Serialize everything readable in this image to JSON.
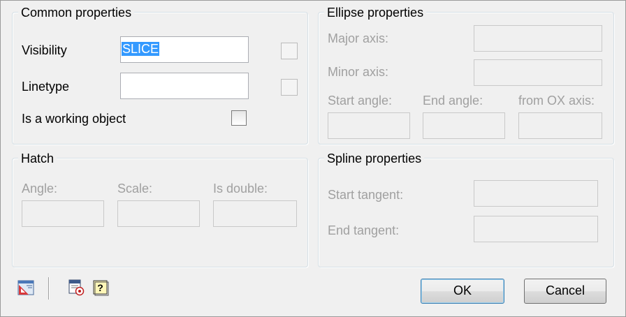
{
  "common": {
    "title": "Common properties",
    "visibility_label": "Visibility",
    "visibility_value": "SLICE",
    "linetype_label": "Linetype",
    "linetype_value": "",
    "working_label": "Is a working object"
  },
  "ellipse": {
    "title": "Ellipse properties",
    "major_label": "Major axis:",
    "minor_label": "Minor axis:",
    "start_label": "Start angle:",
    "end_label": "End angle:",
    "ox_label": "from OX axis:"
  },
  "hatch": {
    "title": "Hatch",
    "angle_label": "Angle:",
    "scale_label": "Scale:",
    "double_label": "Is double:"
  },
  "spline": {
    "title": "Spline properties",
    "start_label": "Start tangent:",
    "end_label": "End  tangent:"
  },
  "buttons": {
    "ok": "OK",
    "cancel": "Cancel"
  },
  "icons": [
    "layer-properties-icon",
    "text-style-icon",
    "help-icon"
  ]
}
